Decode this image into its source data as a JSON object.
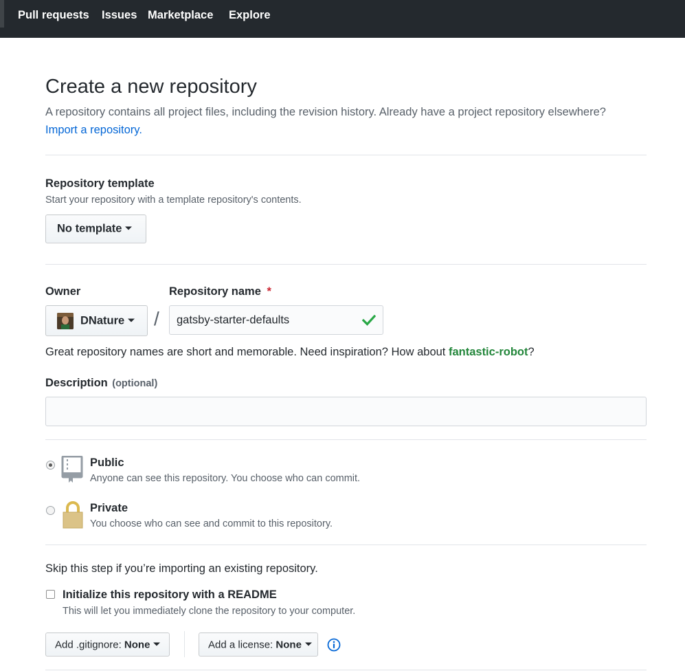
{
  "nav": {
    "items": [
      "Pull requests",
      "Issues",
      "Marketplace",
      "Explore"
    ]
  },
  "header": {
    "title": "Create a new repository",
    "description": "A repository contains all project files, including the revision history. Already have a project repository elsewhere?",
    "import_link": "Import a repository."
  },
  "template": {
    "label": "Repository template",
    "note": "Start your repository with a template repository's contents.",
    "button": "No template"
  },
  "owner": {
    "label": "Owner",
    "value": "DNature"
  },
  "repo": {
    "label": "Repository name",
    "required_mark": "*",
    "separator": "/",
    "value": "gatsby-starter-defaults",
    "hint_prefix": "Great repository names are short and memorable. Need inspiration? How about ",
    "hint_suggestion": "fantastic-robot",
    "hint_suffix": "?"
  },
  "description": {
    "label": "Description",
    "optional": "(optional)",
    "value": ""
  },
  "visibility": {
    "selected": "public",
    "public": {
      "label": "Public",
      "note": "Anyone can see this repository. You choose who can commit."
    },
    "private": {
      "label": "Private",
      "note": "You choose who can see and commit to this repository."
    }
  },
  "init": {
    "skip_text": "Skip this step if you’re importing an existing repository.",
    "readme_label": "Initialize this repository with a README",
    "readme_note": "This will let you immediately clone the repository to your computer.",
    "readme_checked": false,
    "gitignore_prefix": "Add .gitignore: ",
    "gitignore_value": "None",
    "license_prefix": "Add a license: ",
    "license_value": "None"
  },
  "colors": {
    "nav_bg": "#24292e",
    "link": "#0366d6",
    "success": "#28a745",
    "suggestion": "#22863a",
    "required": "#cb2431"
  },
  "icons": [
    "check-icon",
    "repo-icon",
    "lock-icon",
    "info-icon",
    "caret-down-icon"
  ]
}
